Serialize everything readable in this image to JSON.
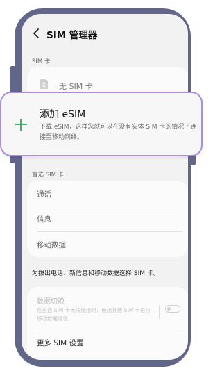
{
  "header": {
    "title": "SIM 管理器"
  },
  "sim_section": {
    "label": "SIM 卡",
    "no_sim_label": "无 SIM 卡"
  },
  "esim_popup": {
    "title": "添加 eSIM",
    "description": "下载 eSIM，这样您就可以在没有实体 SIM 卡的情况下连接至移动网络。"
  },
  "preferred": {
    "label": "首选 SIM 卡",
    "items": [
      {
        "label": "通话"
      },
      {
        "label": "信息"
      },
      {
        "label": "移动数据"
      }
    ]
  },
  "info_text": "为拨出电话、新信息和移动数据选择 SIM 卡。",
  "data_switch": {
    "title": "数据切换",
    "description": "在首选 SIM 卡无法使用时，使用其他 SIM 卡进行移动数据通信。",
    "enabled": false
  },
  "more_settings": {
    "label": "更多 SIM 设置"
  },
  "colors": {
    "frame": "#626789",
    "accent_border": "#a98ddf",
    "plus": "#3bb16b"
  },
  "icons": {
    "back": "back-arrow-icon",
    "sim": "sim-card-icon",
    "add": "plus-icon"
  }
}
